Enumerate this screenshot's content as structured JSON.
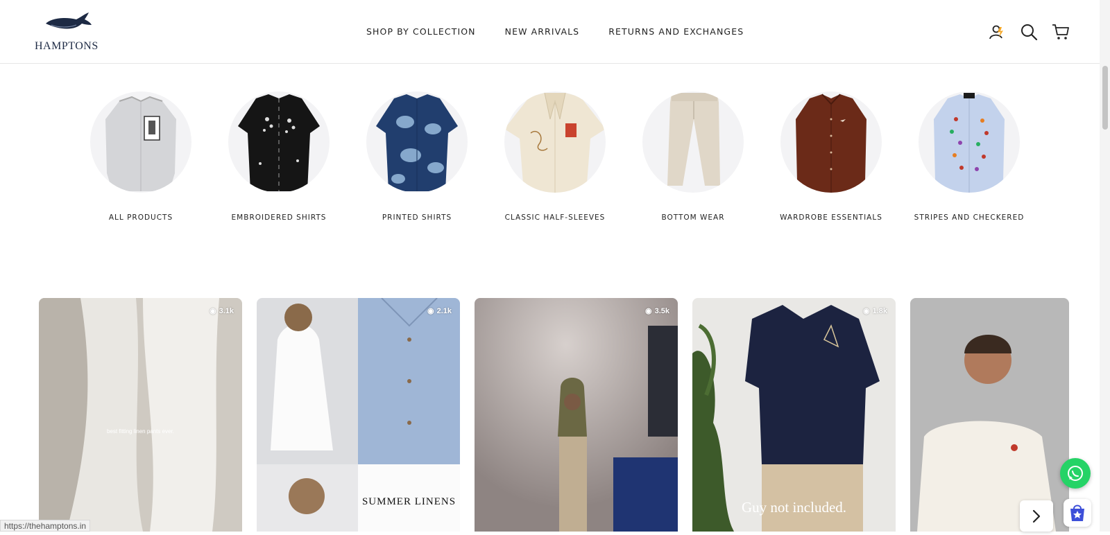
{
  "brand": {
    "name": "HAMPTONS"
  },
  "nav": {
    "items": [
      {
        "label": "SHOP BY COLLECTION"
      },
      {
        "label": "NEW ARRIVALS"
      },
      {
        "label": "RETURNS AND EXCHANGES"
      }
    ]
  },
  "header_icons": [
    "account-icon",
    "search-icon",
    "cart-icon"
  ],
  "categories": [
    {
      "label": "ALL PRODUCTS"
    },
    {
      "label": "EMBROIDERED SHIRTS"
    },
    {
      "label": "PRINTED SHIRTS"
    },
    {
      "label": "CLASSIC HALF-SLEEVES"
    },
    {
      "label": "BOTTOM WEAR"
    },
    {
      "label": "WARDROBE ESSENTIALS"
    },
    {
      "label": "STRIPES AND CHECKERED"
    }
  ],
  "videos": [
    {
      "views": "3.1k",
      "caption": "best fitting linen pants ever."
    },
    {
      "views": "2.1k",
      "caption": "SUMMER LINENS"
    },
    {
      "views": "3.5k",
      "caption": ""
    },
    {
      "views": "1.8k",
      "caption": "Guy not included."
    },
    {
      "views": "",
      "caption": ""
    }
  ],
  "status_url": "https://thehamptons.in",
  "colors": {
    "navy": "#1d2a44",
    "whatsapp": "#25d366"
  }
}
